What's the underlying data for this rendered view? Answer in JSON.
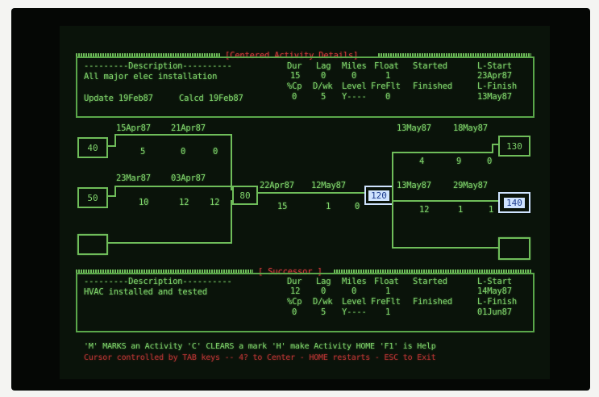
{
  "top_panel": {
    "title": "[Centered Activity Details]",
    "desc_header": "---------Description----------",
    "desc": "All major elec installation",
    "col_headers_1": [
      "Dur",
      "Lag",
      "Miles",
      "Float",
      "Started",
      "L-Start"
    ],
    "values_1": [
      "15",
      "0",
      "0",
      "1",
      "",
      "23Apr87"
    ],
    "col_headers_2": [
      "%Cp",
      "D/wk",
      "Level",
      "FreFlt",
      "Finished",
      "L-Finish"
    ],
    "values_2": [
      "0",
      "5",
      "Y----",
      "0",
      "",
      "13May87"
    ],
    "update": "Update 19Feb87",
    "calcd": "Calcd 19Feb87"
  },
  "network": {
    "nodes": {
      "n40": "40",
      "n50": "50",
      "n80": "80",
      "n120": "120",
      "n130": "130",
      "n140": "140"
    },
    "left_top": {
      "d1": "15Apr87",
      "d2": "21Apr87",
      "v1": "5",
      "v2": "0",
      "v3": "0"
    },
    "left_bot": {
      "d1": "23Mar87",
      "d2": "03Apr87",
      "v1": "10",
      "v2": "12",
      "v3": "12"
    },
    "center": {
      "d1": "22Apr87",
      "d2": "12May87",
      "v1": "15",
      "v2": "1",
      "v3": "0"
    },
    "right_top": {
      "d1": "13May87",
      "d2": "18May87",
      "v1": "4",
      "v2": "9",
      "v3": "0"
    },
    "right_bot": {
      "d1": "13May87",
      "d2": "29May87",
      "v1": "12",
      "v2": "1",
      "v3": "1"
    }
  },
  "bottom_panel": {
    "title": "[ Successor ]",
    "desc_header": "---------Description----------",
    "desc": "HVAC installed and tested",
    "col_headers_1": [
      "Dur",
      "Lag",
      "Miles",
      "Float",
      "Started",
      "L-Start"
    ],
    "values_1": [
      "12",
      "0",
      "0",
      "1",
      "",
      "14May87"
    ],
    "col_headers_2": [
      "%Cp",
      "D/wk",
      "Level",
      "FreFlt",
      "Finished",
      "L-Finish"
    ],
    "values_2": [
      "0",
      "5",
      "Y----",
      "1",
      "",
      "01Jun87"
    ]
  },
  "help": {
    "line1": "'M' MARKS an Activity 'C' CLEARS a mark 'H' make Activity HOME 'F1' is Help",
    "line2": "Cursor controlled by TAB keys -- 4? to Center - HOME restarts - ESC to Exit"
  },
  "colors": {
    "phosphor_green": "#7fd36b",
    "alert_red": "#d23a3a",
    "highlight": "#cfe3ff",
    "screen_bg": "#0a130a"
  }
}
